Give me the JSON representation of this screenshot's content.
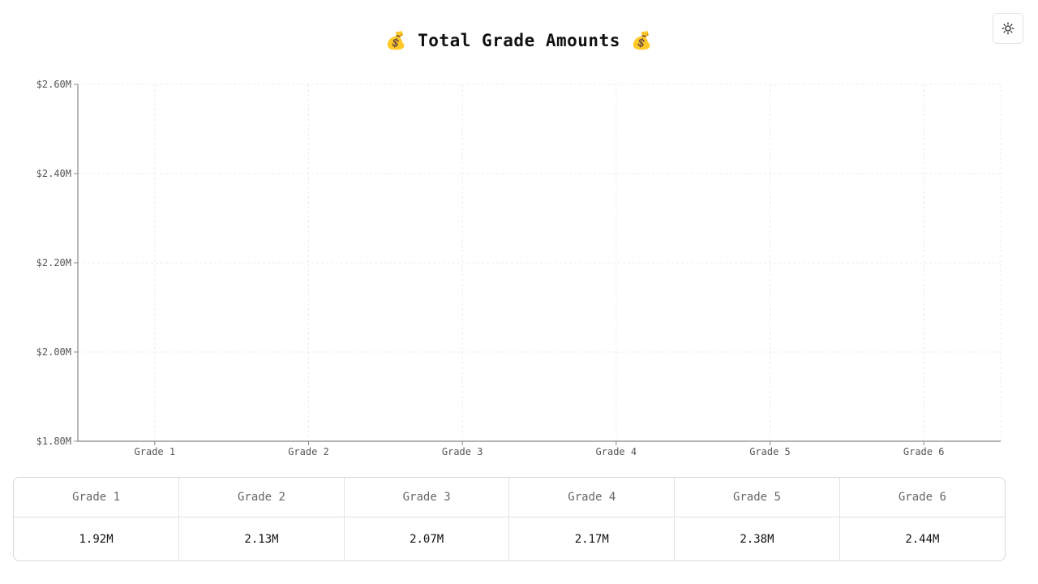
{
  "chart_data": {
    "type": "bar",
    "title": "💰 Total Grade Amounts 💰",
    "categories": [
      "Grade 1",
      "Grade 2",
      "Grade 3",
      "Grade 4",
      "Grade 5",
      "Grade 6"
    ],
    "values": [
      1920000,
      2130000,
      2070000,
      2170000,
      2380000,
      2440000
    ],
    "ylim": [
      1800000,
      2600000
    ],
    "yticks": [
      1800000,
      2000000,
      2200000,
      2400000,
      2600000
    ],
    "ytick_labels": [
      "$1.80M",
      "$2.00M",
      "$2.20M",
      "$2.40M",
      "$2.60M"
    ],
    "xlabel": "",
    "ylabel": "",
    "grid": true,
    "bars_rendered": false
  },
  "table": {
    "headers": [
      "Grade 1",
      "Grade 2",
      "Grade 3",
      "Grade 4",
      "Grade 5",
      "Grade 6"
    ],
    "values": [
      "1.92M",
      "2.13M",
      "2.07M",
      "2.17M",
      "2.38M",
      "2.44M"
    ]
  },
  "theme_toggle": {
    "icon": "sun-icon"
  }
}
